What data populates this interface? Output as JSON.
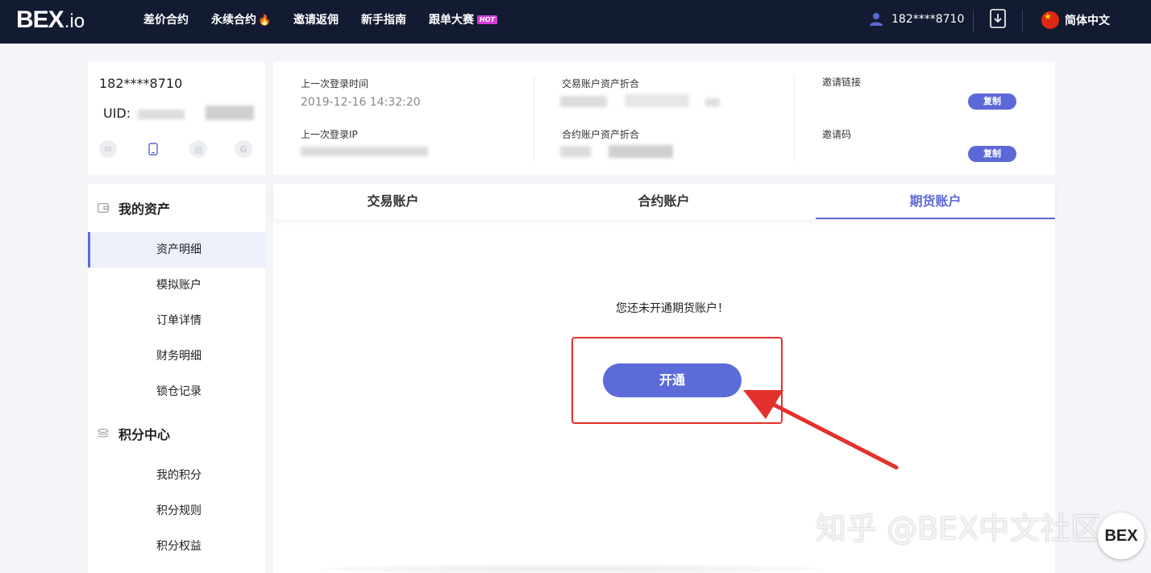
{
  "nav": {
    "logo_main": "BEX",
    "logo_suffix": ".io",
    "items": [
      {
        "label": "差价合约"
      },
      {
        "label": "永续合约"
      },
      {
        "label": "邀请返佣"
      },
      {
        "label": "新手指南"
      },
      {
        "label": "跟单大赛"
      }
    ],
    "hot_badge": "HOT",
    "flame_icon": "flame-icon",
    "user": "182****8710",
    "language": "简体中文"
  },
  "profile": {
    "phone": "182****8710",
    "uid_label": "UID:",
    "icons": [
      "email-icon",
      "phone-icon",
      "card-icon",
      "google-icon"
    ]
  },
  "sidebar": {
    "section1": {
      "title": "我的资产",
      "items": [
        {
          "label": "资产明细"
        },
        {
          "label": "模拟账户"
        },
        {
          "label": "订单详情"
        },
        {
          "label": "财务明细"
        },
        {
          "label": "锁仓记录"
        }
      ]
    },
    "section2": {
      "title": "积分中心",
      "items": [
        {
          "label": "我的积分"
        },
        {
          "label": "积分规则"
        },
        {
          "label": "积分权益"
        }
      ]
    }
  },
  "info": {
    "last_login_time_label": "上一次登录时间",
    "last_login_time": "2019-12-16 14:32:20",
    "last_login_ip_label": "上一次登录IP",
    "trade_assets_label": "交易账户资产折合",
    "contract_assets_label": "合约账户资产折合",
    "invite_link_label": "邀请链接",
    "invite_code_label": "邀请码",
    "copy_label": "复制"
  },
  "main": {
    "tabs": [
      {
        "label": "交易账户"
      },
      {
        "label": "合约账户"
      },
      {
        "label": "期货账户"
      }
    ],
    "active_tab": 2,
    "empty_message": "您还未开通期货账户！",
    "open_button": "开通"
  },
  "colors": {
    "nav_bg": "#131b32",
    "accent": "#5b68d8",
    "highlight": "#e5312d"
  },
  "watermark": {
    "text": "知乎 @BEX中文社区",
    "logo": "BEX"
  }
}
